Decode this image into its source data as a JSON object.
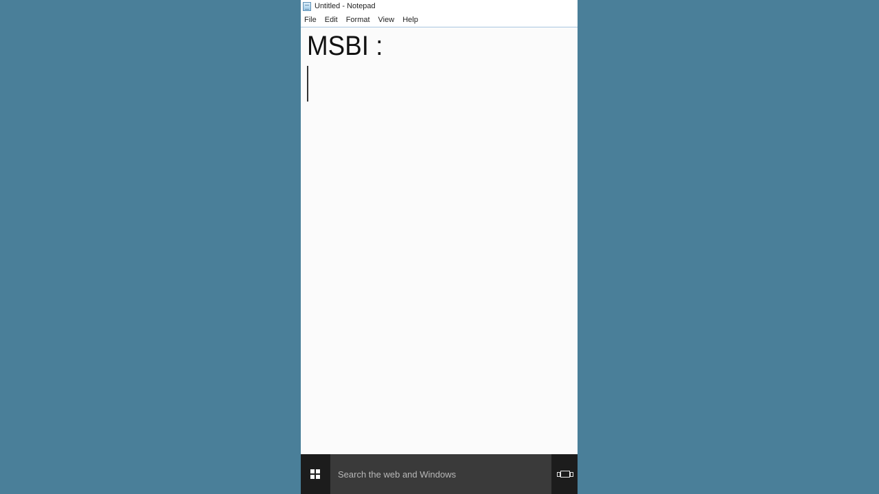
{
  "window": {
    "title": "Untitled - Notepad",
    "app_icon": "notepad-icon"
  },
  "menu": {
    "items": [
      {
        "label": "File"
      },
      {
        "label": "Edit"
      },
      {
        "label": "Format"
      },
      {
        "label": "View"
      },
      {
        "label": "Help"
      }
    ]
  },
  "editor": {
    "content": "MSBI :"
  },
  "taskbar": {
    "start_icon": "windows-logo-icon",
    "search_placeholder": "Search the web and Windows",
    "task_view_icon": "task-view-icon"
  },
  "colors": {
    "desktop_background": "#4a7f99",
    "taskbar": "#1c1c1c",
    "search_box": "#3a3a3a"
  }
}
